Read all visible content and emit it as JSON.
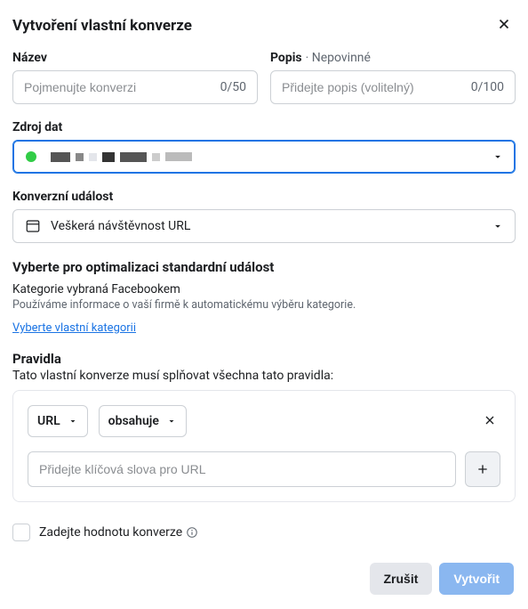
{
  "header": {
    "title": "Vytvoření vlastní konverze"
  },
  "name": {
    "label": "Název",
    "placeholder": "Pojmenujte konverzi",
    "counter": "0/50"
  },
  "desc": {
    "label": "Popis",
    "optional": "· Nepovinné",
    "placeholder": "Přidejte popis (volitelný)",
    "counter": "0/100"
  },
  "source": {
    "label": "Zdroj dat"
  },
  "event": {
    "label": "Konverzní událost",
    "value": "Veškerá návštěvnost URL"
  },
  "optimize": {
    "title": "Vyberte pro optimalizaci standardní událost",
    "sub": "Kategorie vybraná Facebookem",
    "desc": "Používáme informace o vaší firmě k automatickému výběru kategorie.",
    "link": "Vyberte vlastní kategorii"
  },
  "rules": {
    "title": "Pravidla",
    "desc": "Tato vlastní konverze musí splňovat všechna tato pravidla:",
    "dd1": "URL",
    "dd2": "obsahuje",
    "placeholder": "Přidejte klíčová slova pro URL"
  },
  "checkbox": {
    "label": "Zadejte hodnotu konverze"
  },
  "footer": {
    "cancel": "Zrušit",
    "create": "Vytvořit"
  }
}
